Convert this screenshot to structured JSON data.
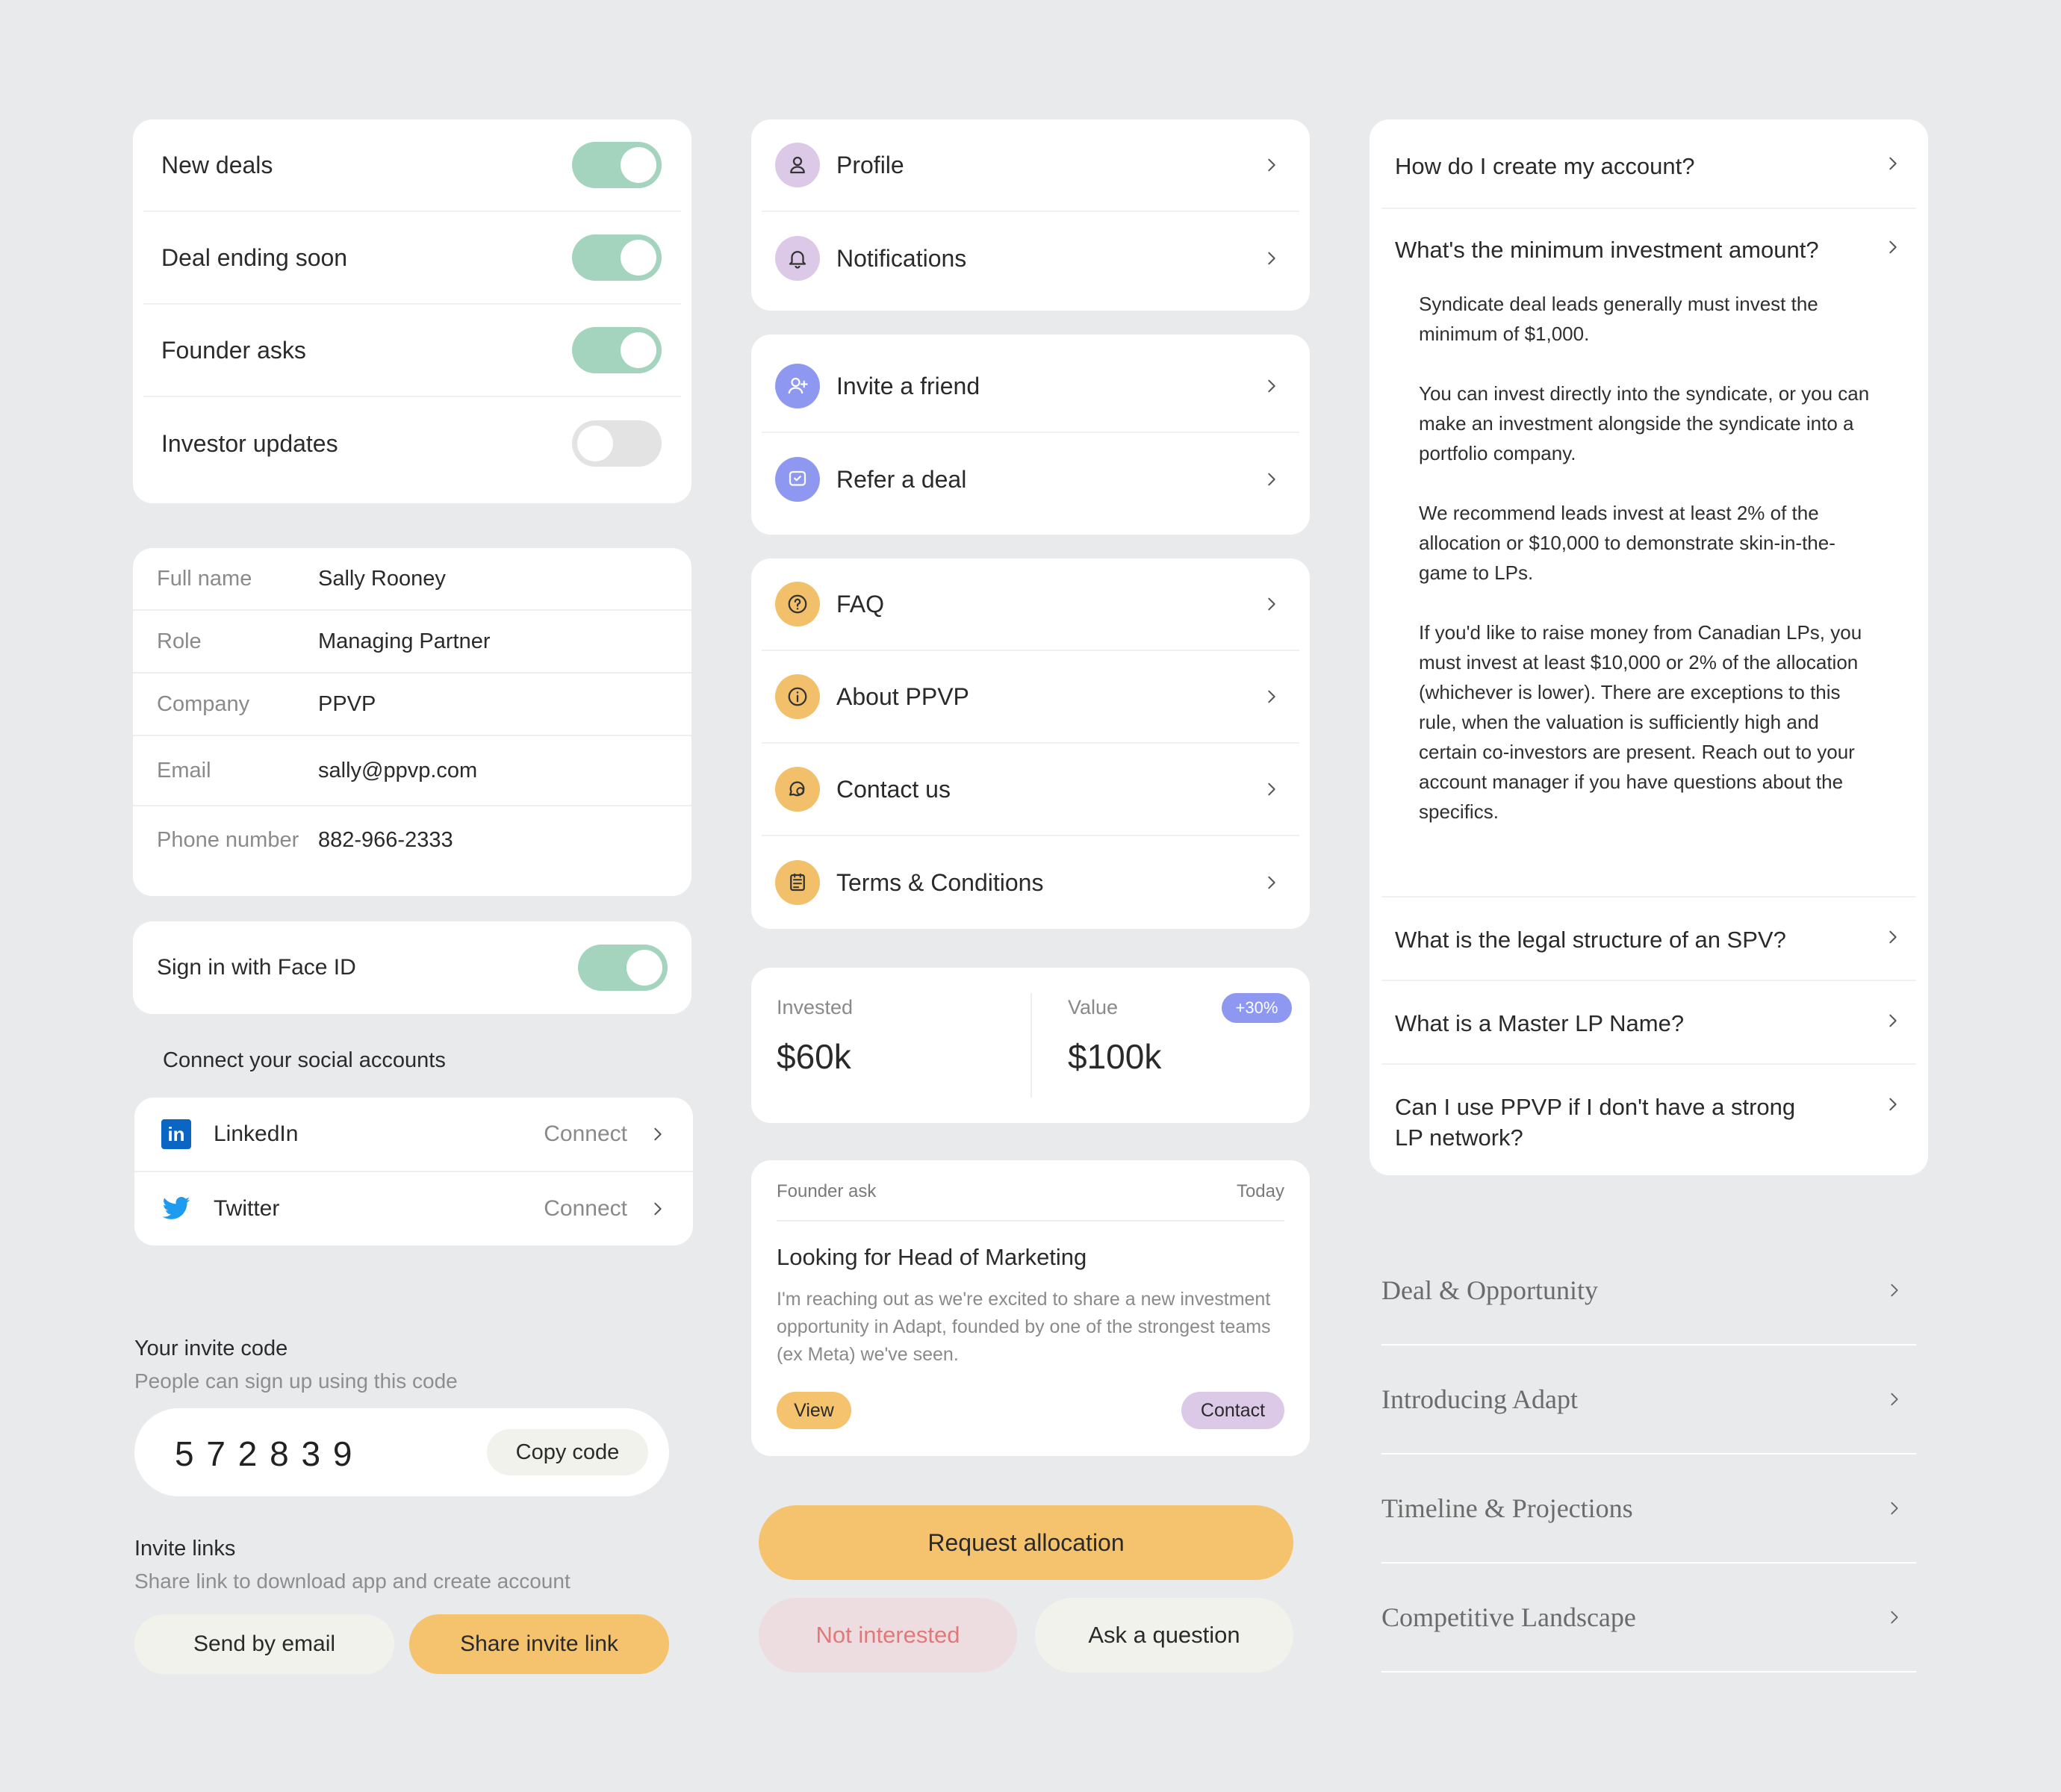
{
  "notifications": {
    "items": [
      {
        "label": "New deals",
        "on": true
      },
      {
        "label": "Deal ending soon",
        "on": true
      },
      {
        "label": "Founder asks",
        "on": true
      },
      {
        "label": "Investor updates",
        "on": false
      }
    ]
  },
  "profile": {
    "fields": [
      {
        "label": "Full name",
        "value": "Sally Rooney"
      },
      {
        "label": "Role",
        "value": "Managing Partner"
      },
      {
        "label": "Company",
        "value": "PPVP"
      },
      {
        "label": "Email",
        "value": "sally@ppvp.com"
      },
      {
        "label": "Phone number",
        "value": "882-966-2333"
      }
    ]
  },
  "face_id": {
    "label": "Sign in with Face ID",
    "on": true
  },
  "social": {
    "heading": "Connect your social accounts",
    "items": [
      {
        "name": "LinkedIn",
        "action": "Connect",
        "icon": "linkedin-icon"
      },
      {
        "name": "Twitter",
        "action": "Connect",
        "icon": "twitter-icon"
      }
    ]
  },
  "invite": {
    "title": "Your invite code",
    "subtitle": "People can sign up using this code",
    "code": "5 7 2 8 3 9",
    "copy_label": "Copy code",
    "links_title": "Invite links",
    "links_subtitle": "Share link to download app and create account",
    "email_label": "Send by email",
    "share_label": "Share invite link"
  },
  "menu": {
    "group1": [
      {
        "label": "Profile",
        "icon": "user-icon"
      },
      {
        "label": "Notifications",
        "icon": "bell-icon"
      }
    ],
    "group2": [
      {
        "label": "Invite a friend",
        "icon": "user-plus-icon"
      },
      {
        "label": "Refer a deal",
        "icon": "refer-icon"
      }
    ],
    "group3": [
      {
        "label": "FAQ",
        "icon": "question-icon"
      },
      {
        "label": "About PPVP",
        "icon": "info-icon"
      },
      {
        "label": "Contact us",
        "icon": "chat-icon"
      },
      {
        "label": "Terms & Conditions",
        "icon": "document-icon"
      }
    ]
  },
  "stats": {
    "invested_label": "Invested",
    "invested_value": "$60k",
    "value_label": "Value",
    "value_value": "$100k",
    "change_badge": "+30%"
  },
  "founder_ask": {
    "tag": "Founder ask",
    "date": "Today",
    "title": "Looking for Head of Marketing",
    "body": "I'm reaching out as we're excited to share a new investment opportunity in Adapt, founded by one of the strongest teams (ex Meta) we've seen.",
    "view_label": "View",
    "contact_label": "Contact"
  },
  "actions": {
    "request_label": "Request allocation",
    "not_interested_label": "Not interested",
    "ask_label": "Ask a question"
  },
  "faq": {
    "q1": "How do I create my account?",
    "q2": "What's the minimum investment amount?",
    "answer": [
      "Syndicate deal leads generally must invest the minimum of $1,000.",
      "You can invest directly into the syndicate, or you can make an investment alongside the syndicate into a portfolio company.",
      "We recommend leads invest at least 2% of the allocation or $10,000 to demonstrate skin-in-the-game to LPs.",
      "If you'd like to raise money from Canadian LPs, you must invest at least $10,000 or 2% of the allocation (whichever is lower). There are exceptions to this rule, when the valuation is sufficiently high and certain co-investors are present. Reach out to your account manager if you have questions about the specifics."
    ],
    "q3": "What is the legal structure of an SPV?",
    "q4": "What is a Master LP Name?",
    "q5": "Can I use PPVP if I don't have a strong LP network?"
  },
  "deal_sections": [
    "Deal & Opportunity",
    "Introducing Adapt",
    "Timeline & Projections",
    "Competitive Landscape"
  ],
  "colors": {
    "background": "#e9eaec",
    "toggle_on": "#a4d4be",
    "accent_orange": "#f5c36e",
    "accent_purple": "#dcc9e8",
    "accent_blue": "#8e98f0",
    "danger_text": "#e07a7a"
  }
}
